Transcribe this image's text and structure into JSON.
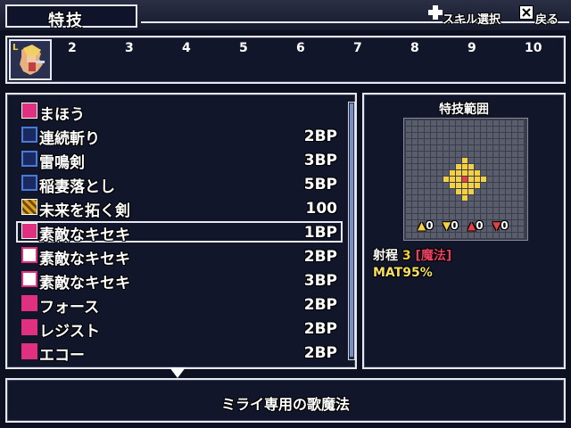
{
  "header": {
    "title": "特技",
    "hint_select_label": "スキル選択",
    "hint_back_label": "戻る"
  },
  "party": {
    "level_badge": "L",
    "slot_numbers": [
      "2",
      "3",
      "4",
      "5",
      "6",
      "7",
      "8",
      "9",
      "10"
    ]
  },
  "skills": [
    {
      "name": "まほう",
      "cost": "",
      "icon": "magic-category-icon",
      "icon_color": "#e03080"
    },
    {
      "name": "連続斬り",
      "cost": "2BP",
      "icon": "slash-skill-icon",
      "icon_color": "#4a7ad8"
    },
    {
      "name": "雷鳴剣",
      "cost": "3BP",
      "icon": "thunder-sword-icon",
      "icon_color": "#4a7ad8"
    },
    {
      "name": "稲妻落とし",
      "cost": "5BP",
      "icon": "lightning-drop-icon",
      "icon_color": "#4a7ad8"
    },
    {
      "name": "未来を拓く剣",
      "cost": "100",
      "icon": "future-sword-icon",
      "icon_color": "#e0a020"
    },
    {
      "name": "素敵なキセキ",
      "cost": "1BP",
      "icon": "miracle-song-icon",
      "icon_color": "#e03080"
    },
    {
      "name": "素敵なキセキ",
      "cost": "2BP",
      "icon": "miracle-song-plus1-icon",
      "icon_color": "#e03080"
    },
    {
      "name": "素敵なキセキ",
      "cost": "3BP",
      "icon": "miracle-song-plus2-icon",
      "icon_color": "#e03080"
    },
    {
      "name": "フォース",
      "cost": "2BP",
      "icon": "vo-force-icon",
      "icon_color": "#e03080"
    },
    {
      "name": "レジスト",
      "cost": "2BP",
      "icon": "vo-resist-icon",
      "icon_color": "#e03080"
    },
    {
      "name": "エコー",
      "cost": "2BP",
      "icon": "vo-echo-icon",
      "icon_color": "#e03080"
    }
  ],
  "selected_index": 5,
  "range_panel": {
    "title": "特技範囲",
    "stats": [
      "0",
      "0",
      "0",
      "0"
    ],
    "range_label": "射程",
    "range_value": "3",
    "range_type": "[魔法]",
    "mat_text": "MAT95%"
  },
  "description": "ミライ専用の歌魔法",
  "colors": {
    "highlight_yellow": "#f5d040",
    "magic_red": "#e03080",
    "grid_bg": "#3a3d4c",
    "range_cell": "#f5d040",
    "center_cell": "#e84040"
  }
}
